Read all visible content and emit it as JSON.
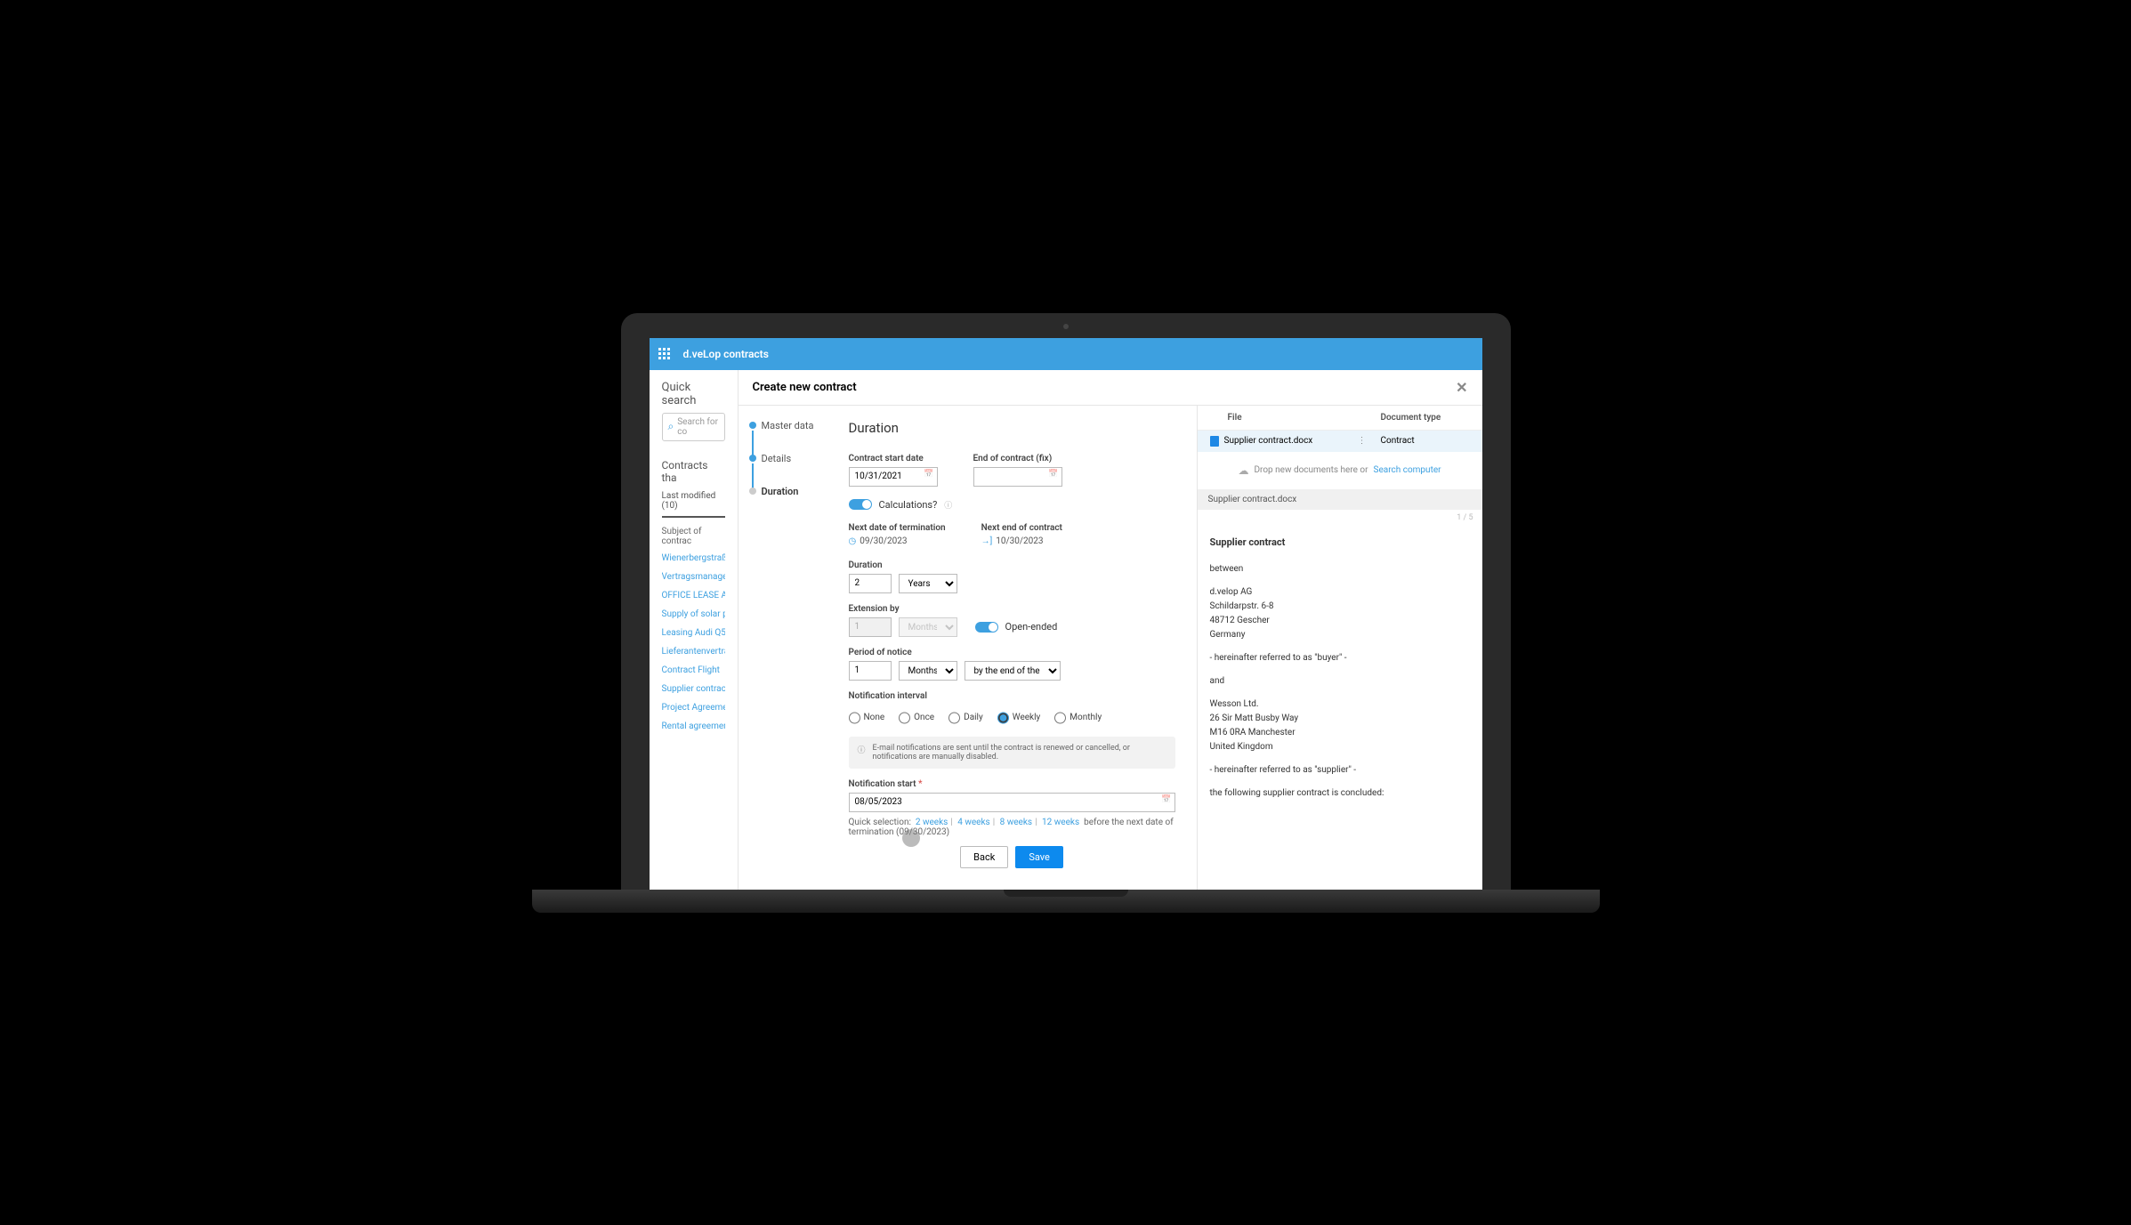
{
  "brand": "d.veLop",
  "brand_suffix": "contracts",
  "left": {
    "quick_search": "Quick search",
    "search_placeholder": "Search for co",
    "contracts_heading": "Contracts tha",
    "tab": "Last modified (10)",
    "subject_label": "Subject of contrac",
    "items": [
      "Wienerbergstraße",
      "Vertragsmanagem",
      "OFFICE LEASE AGR",
      "Supply of solar pa",
      "Leasing Audi Q5",
      "Lieferantenvertrag",
      "Contract Flight",
      "Supplier contract c",
      "Project Agreement",
      "Rental agreement"
    ]
  },
  "modal": {
    "title": "Create new contract",
    "steps": [
      "Master data",
      "Details",
      "Duration"
    ]
  },
  "form": {
    "heading": "Duration",
    "contract_start_label": "Contract start date",
    "contract_start": "10/31/2021",
    "end_fix_label": "End of contract (fix)",
    "end_fix": "",
    "calculations_label": "Calculations?",
    "next_termination_label": "Next date of termination",
    "next_termination": "09/30/2023",
    "next_end_label": "Next end of contract",
    "next_end": "10/30/2023",
    "duration_label": "Duration",
    "duration_value": "2",
    "duration_unit": "Years",
    "extension_label": "Extension by",
    "extension_value": "1",
    "extension_unit": "Months",
    "openended_label": "Open-ended",
    "notice_label": "Period of notice",
    "notice_value": "1",
    "notice_unit": "Months",
    "notice_by": "by the end of the contract",
    "interval_label": "Notification interval",
    "interval_options": [
      "None",
      "Once",
      "Daily",
      "Weekly",
      "Monthly"
    ],
    "interval_selected": "Weekly",
    "info_text": "E-mail notifications are sent until the contract is renewed or cancelled, or notifications are manually disabled.",
    "notif_start_label": "Notification start",
    "notif_start": "08/05/2023",
    "quick_label": "Quick selection:",
    "quick_opts": [
      "2 weeks",
      "4 weeks",
      "8 weeks",
      "12 weeks"
    ],
    "quick_suffix": "before the next date of termination (09/30/2023)",
    "back": "Back",
    "save": "Save"
  },
  "files": {
    "col_file": "File",
    "col_type": "Document type",
    "row_name": "Supplier contract.docx",
    "row_type": "Contract",
    "drop_text": "Drop new documents here or",
    "drop_link": "Search computer",
    "preview_name": "Supplier contract.docx",
    "page": "1 / 5"
  },
  "doc": {
    "title": "Supplier contract",
    "between": "between",
    "party1_l1": "d.velop AG",
    "party1_l2": "Schildarpstr. 6-8",
    "party1_l3": "48712 Gescher",
    "party1_l4": "Germany",
    "ref1": "- hereinafter referred to as \"buyer\" -",
    "and": "and",
    "party2_l1": "Wesson Ltd.",
    "party2_l2": "26 Sir Matt Busby Way",
    "party2_l3": "M16 0RA Manchester",
    "party2_l4": "United Kingdom",
    "ref2": "- hereinafter referred to as \"supplier\" -",
    "conclusion": "the following supplier contract is concluded:"
  }
}
